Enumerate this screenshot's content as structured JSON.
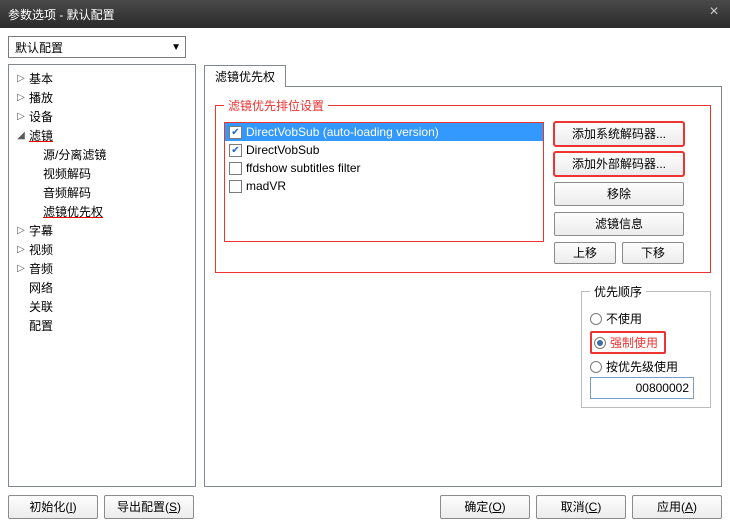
{
  "title": "参数选项 - 默认配置",
  "preset": {
    "value": "默认配置"
  },
  "tree": [
    {
      "label": "基本",
      "level": 1,
      "exp": "▷"
    },
    {
      "label": "播放",
      "level": 1,
      "exp": "▷"
    },
    {
      "label": "设备",
      "level": 1,
      "exp": "▷"
    },
    {
      "label": "滤镜",
      "level": 1,
      "exp": "◢",
      "u": true
    },
    {
      "label": "源/分离滤镜",
      "level": 2,
      "exp": ""
    },
    {
      "label": "视频解码",
      "level": 2,
      "exp": ""
    },
    {
      "label": "音频解码",
      "level": 2,
      "exp": ""
    },
    {
      "label": "滤镜优先权",
      "level": 2,
      "exp": "",
      "u": true
    },
    {
      "label": "字幕",
      "level": 1,
      "exp": "▷"
    },
    {
      "label": "视频",
      "level": 1,
      "exp": "▷"
    },
    {
      "label": "音频",
      "level": 1,
      "exp": "▷"
    },
    {
      "label": "网络",
      "level": 1,
      "exp": ""
    },
    {
      "label": "关联",
      "level": 1,
      "exp": ""
    },
    {
      "label": "配置",
      "level": 1,
      "exp": ""
    }
  ],
  "tab": {
    "label": "滤镜优先权"
  },
  "filter_group_legend": "滤镜优先排位设置",
  "filters": [
    {
      "name": "DirectVobSub (auto-loading version)",
      "checked": true,
      "selected": true
    },
    {
      "name": "DirectVobSub",
      "checked": true,
      "selected": false
    },
    {
      "name": "ffdshow subtitles filter",
      "checked": false,
      "selected": false
    },
    {
      "name": "madVR",
      "checked": false,
      "selected": false
    }
  ],
  "buttons": {
    "add_sys": "添加系统解码器...",
    "add_ext": "添加外部解码器...",
    "remove": "移除",
    "info": "滤镜信息",
    "up": "上移",
    "down": "下移"
  },
  "priority_legend": "优先顺序",
  "priority_options": {
    "none": "不使用",
    "force": "强制使用",
    "by_prio": "按优先级使用"
  },
  "priority_value": "00800002",
  "bottom": {
    "init_text": "初始化",
    "init_key": "I",
    "export_text": "导出配置",
    "export_key": "S",
    "ok_text": "确定",
    "ok_key": "O",
    "cancel_text": "取消",
    "cancel_key": "C",
    "apply_text": "应用",
    "apply_key": "A"
  }
}
